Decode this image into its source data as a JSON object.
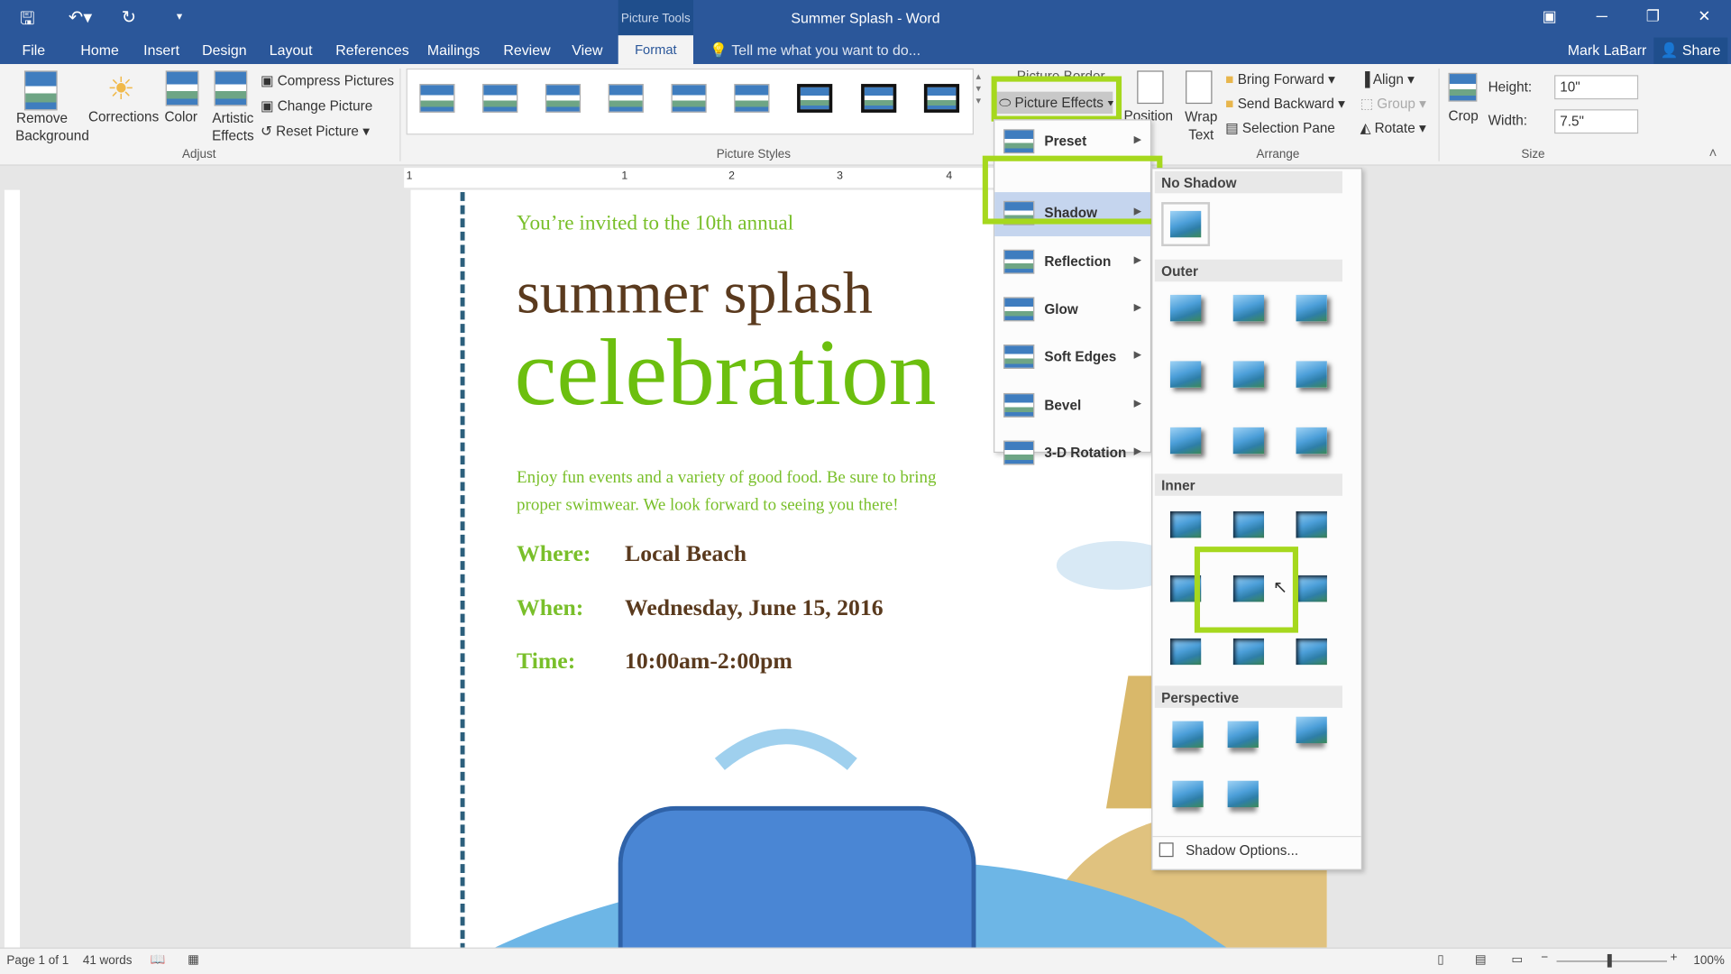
{
  "title_bar": {
    "title": "Summer Splash - Word",
    "context_tab": "Picture Tools",
    "user": "Mark LaBarr",
    "share": "Share"
  },
  "tabs": [
    "File",
    "Home",
    "Insert",
    "Design",
    "Layout",
    "References",
    "Mailings",
    "Review",
    "View",
    "Format"
  ],
  "tell_me": "Tell me what you want to do...",
  "ribbon": {
    "adjust": {
      "remove_background": "Remove Background",
      "corrections": "Corrections",
      "color": "Color",
      "artistic_effects": "Artistic Effects",
      "compress": "Compress Pictures",
      "change": "Change Picture",
      "reset": "Reset Picture",
      "group": "Adjust"
    },
    "styles": {
      "group": "Picture Styles",
      "count": 9
    },
    "picture_border": "Picture Border",
    "picture_effects": "Picture Effects",
    "arrange": {
      "position": "Position",
      "wrap_text": "Wrap Text",
      "bring_forward": "Bring Forward",
      "send_backward": "Send Backward",
      "selection_pane": "Selection Pane",
      "align": "Align",
      "group_btn": "Group",
      "rotate": "Rotate",
      "group": "Arrange"
    },
    "size": {
      "crop": "Crop",
      "height_label": "Height:",
      "height": "10\"",
      "width_label": "Width:",
      "width": "7.5\"",
      "group": "Size"
    }
  },
  "effects_menu": [
    "Preset",
    "Shadow",
    "Reflection",
    "Glow",
    "Soft Edges",
    "Bevel",
    "3-D Rotation"
  ],
  "shadow_menu": {
    "no_shadow": "No Shadow",
    "outer": "Outer",
    "inner": "Inner",
    "perspective": "Perspective",
    "options": "Shadow Options..."
  },
  "document": {
    "invite": "You’re invited to the 10th annual",
    "title1": "summer splash",
    "title2": "celebration",
    "body1": "Enjoy fun events and a variety of good food. Be sure to bring",
    "body2": "proper swimwear. We look forward to seeing you there!",
    "where_label": "Where:",
    "where": "Local Beach",
    "when_label": "When:",
    "when": "Wednesday, June 15, 2016",
    "time_label": "Time:",
    "time": "10:00am-2:00pm"
  },
  "ruler_numbers": [
    "1",
    "1",
    "2",
    "3",
    "4"
  ],
  "status": {
    "page": "Page 1 of 1",
    "words": "41 words",
    "zoom": "100%"
  },
  "colors": {
    "accent": "#2b579a",
    "highlight": "#a6d81e",
    "green_text": "#6cbf0f",
    "brown_text": "#5a3a1e"
  }
}
